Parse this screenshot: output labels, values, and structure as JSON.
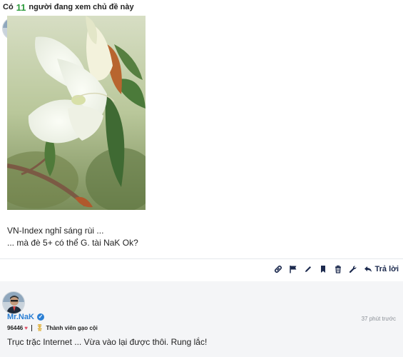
{
  "viewers": {
    "prefix": "Có",
    "count": "11",
    "suffix": "người đang xem chủ đề này"
  },
  "post1": {
    "line1": "VN-Index nghỉ sáng rùi ...",
    "line2": "... mà đè 5+ có thể G. tài NaK Ok?",
    "actions": {
      "reply_label": "Trả lời",
      "icons": [
        "link-icon",
        "flag-icon",
        "pencil-icon",
        "bookmark-icon",
        "trash-icon",
        "wrench-icon",
        "reply-icon"
      ]
    }
  },
  "post2": {
    "username": "Mr.NaK",
    "timestamp": "37 phút trước",
    "score": "96446",
    "title": "Thành viên gạo cội",
    "text": "Trục trặc Internet ... Vừa vào lại được thôi. Rung lắc!"
  },
  "colors": {
    "accent": "#2b7fd4",
    "viewer_count": "#2e9c3d",
    "heart": "#e25168",
    "action_icons": "#1c2a4e",
    "post2_bg": "#f4f5f7"
  }
}
